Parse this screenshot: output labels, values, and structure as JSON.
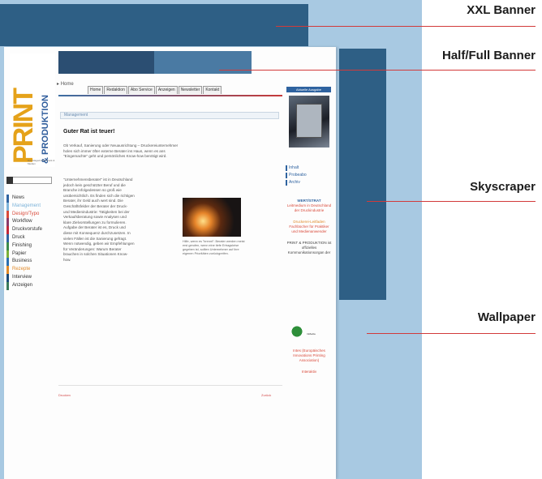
{
  "labels": {
    "xxl": "XXL Banner",
    "half_full": "Half/Full  Banner",
    "skyscraper": "Skyscraper",
    "wallpaper": "Wallpaper"
  },
  "colors": {
    "banner_dark": "#2e5f85",
    "wallpaper": "#a8c9e2",
    "callout_line": "#d23a3a"
  },
  "site": {
    "logo_print": "PRINT",
    "logo_produktion": "& PRODUKTION",
    "logo_tagline": "Das Magazin für Druck & Medien",
    "breadcrumb": "Home",
    "tabs": [
      "Home",
      "Redaktion",
      "Abo Service",
      "Anzeigen",
      "Newsletter",
      "Kontakt"
    ],
    "nav": [
      {
        "label": "News",
        "color": "#2f63a0"
      },
      {
        "label": "Management",
        "color": "#7db3d9"
      },
      {
        "label": "Design/Typo",
        "color": "#d94a3a"
      },
      {
        "label": "Workflow",
        "color": "#8a3a6a"
      },
      {
        "label": "Druckvorstufe",
        "color": "#c0283a"
      },
      {
        "label": "Druck",
        "color": "#2f63a0"
      },
      {
        "label": "Finishing",
        "color": "#3a8a4a"
      },
      {
        "label": "Papier",
        "color": "#7ab03a"
      },
      {
        "label": "Business",
        "color": "#2a6fb0"
      },
      {
        "label": "Rezepte",
        "color": "#e08a2a"
      },
      {
        "label": "Interview",
        "color": "#1a4a7a"
      },
      {
        "label": "Anzeigen",
        "color": "#3a7a5a"
      }
    ],
    "section": "Management",
    "headline": "Guter Rat ist teuer!",
    "paragraph_intro": "Ob Verkauf, Sanierung oder Neuausrichtung – Druckereiunternehmer holen sich immer öfter externe Berater ins Haus, wenn es ans \"Eingemachte\" geht und persönliches Know-how benötigt wird.",
    "paragraph_body": "\"Unternehmensberater\" ist in Deutschland jedoch kein geschützter Beruf und die Branche infolgedessen so groß wie unübersichtlich. Es finden sich die richtigen Berater, ihr Geld auch wert sind. Die Geschäftsfelder der Berater der Druck- und Medienindustrie: Tätigkeiten bei der Verkaufsberatung sowie Analysen und klare Zielvorstellungen zu formulieren. Aufgabe der Berater ist es, Druck und diese mit Konsequenz durchzusetzen. In vielen Fällen ist die Sanierung gefragt. Wenn notwendig, geben wir Empfehlungen für Veränderungen: Warum Berater brauchen in solchen Situationen Know-how.",
    "caption": "Hilfe, wenn es \"brennt\": Berater werden meist erst gerufen, wenn eine tiefe Ertragskrise gegeben ist, sollten Unternehmer auf ihre eigenen Prioritäten zurückgreifen.",
    "footer_left": "Drucken",
    "footer_right": "Zurück",
    "right": {
      "aktuelle": "Aktuelle Ausgabe",
      "links": [
        "Inhalt",
        "Probeabo",
        "Archiv"
      ],
      "brand": "WERT/STRAT",
      "partner_text": "Leitmedium in Deutschland der Druckindustrie",
      "guides_title": "Druckerei-Leitfaden",
      "guides_text": "Fachbücher für Praktiker und Medienanwender",
      "official_text": "PRINT & PRODUKTION ist offizielles Kommunikationsorgan der",
      "inmedia": "InMedia",
      "inmedia_text": "Intes (Europäisches Innovations Printing Association)",
      "bottom_link": "Interaktiv"
    }
  }
}
